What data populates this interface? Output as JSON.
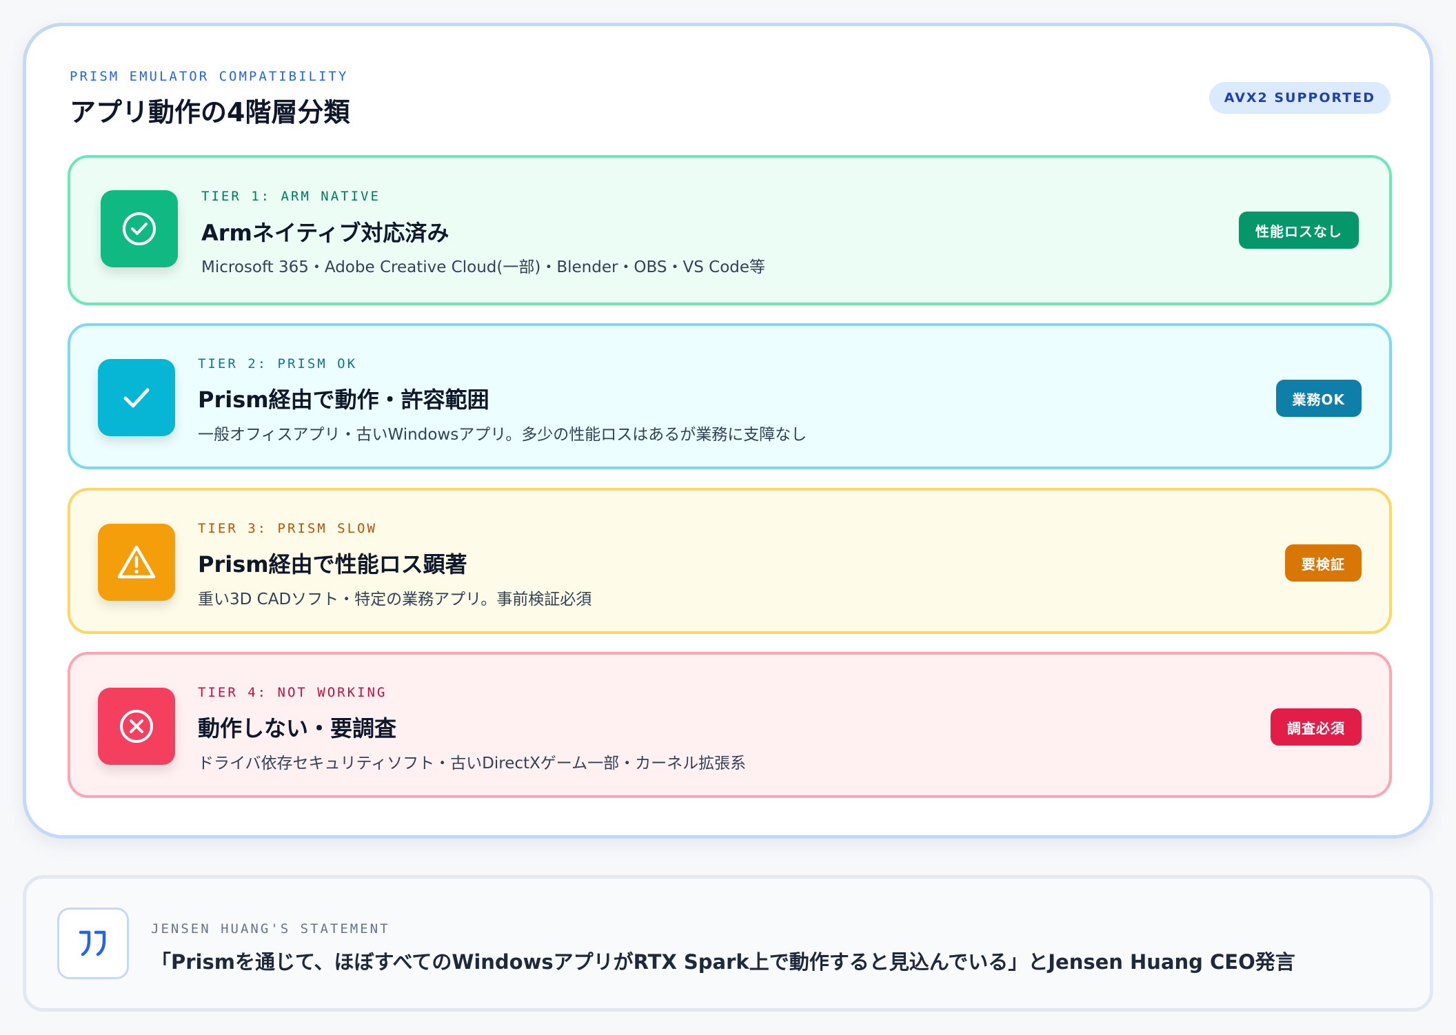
{
  "header": {
    "eyebrow": "PRISM EMULATOR COMPATIBILITY",
    "title": "アプリ動作の4階層分類",
    "pill": "AVX2 SUPPORTED"
  },
  "tiers": [
    {
      "label": "TIER 1: ARM NATIVE",
      "title": "Armネイティブ対応済み",
      "desc": "Microsoft 365・Adobe Creative Cloud(一部)・Blender・OBS・VS Code等",
      "badge": "性能ロスなし",
      "icon": "check-circle-icon",
      "color": "#10b981"
    },
    {
      "label": "TIER 2: PRISM OK",
      "title": "Prism経由で動作・許容範囲",
      "desc": "一般オフィスアプリ・古いWindowsアプリ。多少の性能ロスはあるが業務に支障なし",
      "badge": "業務OK",
      "icon": "check-icon",
      "color": "#06b6d4"
    },
    {
      "label": "TIER 3: PRISM SLOW",
      "title": "Prism経由で性能ロス顕著",
      "desc": "重い3D CADソフト・特定の業務アプリ。事前検証必須",
      "badge": "要検証",
      "icon": "warning-icon",
      "color": "#f59e0b"
    },
    {
      "label": "TIER 4: NOT WORKING",
      "title": "動作しない・要調査",
      "desc": "ドライバ依存セキュリティソフト・古いDirectXゲーム一部・カーネル拡張系",
      "badge": "調査必須",
      "icon": "x-circle-icon",
      "color": "#f43f5e"
    }
  ],
  "quote": {
    "label": "JENSEN HUANG'S STATEMENT",
    "text": "「Prismを通じて、ほぼすべてのWindowsアプリがRTX Spark上で動作すると見込んでいる」とJensen Huang CEO発言",
    "icon": "quote-icon"
  }
}
